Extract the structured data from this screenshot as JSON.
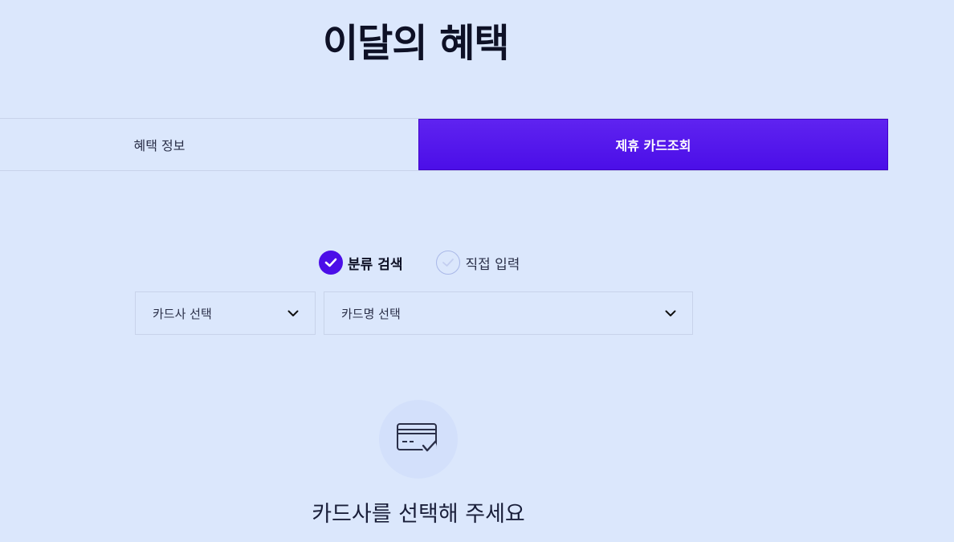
{
  "page": {
    "title": "이달의 혜택"
  },
  "tabs": [
    {
      "label": "혜택 정보",
      "active": false
    },
    {
      "label": "제휴 카드조회",
      "active": true
    }
  ],
  "search_mode": {
    "options": [
      {
        "label": "분류 검색",
        "selected": true
      },
      {
        "label": "직접 입력",
        "selected": false
      }
    ]
  },
  "selects": {
    "company": {
      "value": "카드사 선택"
    },
    "card": {
      "value": "카드명 선택"
    }
  },
  "empty_state": {
    "icon": "card-check-icon",
    "message": "카드사를 선택해 주세요"
  },
  "colors": {
    "background": "#dbe7fc",
    "accent": "#4b0ee8",
    "text": "#1a1f3a"
  }
}
